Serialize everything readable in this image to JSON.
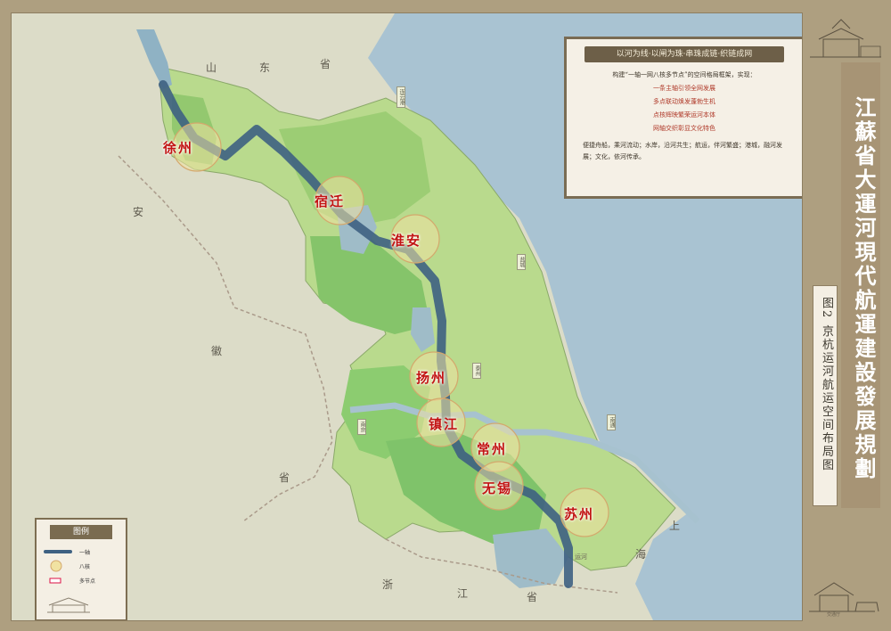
{
  "title": "江蘇省大運河現代航運建設發展規劃",
  "subtitle": "图2 京杭运河航运空间布局图",
  "info_box": {
    "banner": "以河为线·以闸为珠·串珠成链·织链成网",
    "intro": "构建“一轴一网八核多节点”的空间格局框架，实现：",
    "points": [
      "一条主轴引领全网发展",
      "多点联动焕发蓬勃生机",
      "点核辉映繁荣运河本体",
      "网轴交织彰显文化特色"
    ],
    "footer": "便捷舟船，乘河流动；水岸，沿河共生；航运，伴河繁盛；港城，融河发展；文化，依河传承。"
  },
  "legend": {
    "title": "图例",
    "items": [
      {
        "symbol": "line",
        "label": "一轴"
      },
      {
        "symbol": "circle",
        "label": "八核"
      },
      {
        "symbol": "node",
        "label": "多节点"
      }
    ]
  },
  "cities": [
    "徐州",
    "宿迁",
    "淮安",
    "扬州",
    "镇江",
    "常州",
    "无锡",
    "苏州"
  ],
  "provinces": [
    "山",
    "东",
    "省",
    "安",
    "徽",
    "省",
    "浙",
    "江",
    "省",
    "上",
    "海"
  ],
  "service_areas": [
    "连云港",
    "盐城",
    "南通",
    "泰州",
    "南京"
  ],
  "river_label": "运河",
  "publisher": "交通厅",
  "colors": {
    "canal": "#3e6182",
    "core_circle": "#f1e2a2",
    "jiangsu_green": "#a6cf78",
    "sea": "#a9c3d2",
    "frame": "#ae9f80",
    "title_panel": "#a79475",
    "city_label": "#c21313"
  }
}
